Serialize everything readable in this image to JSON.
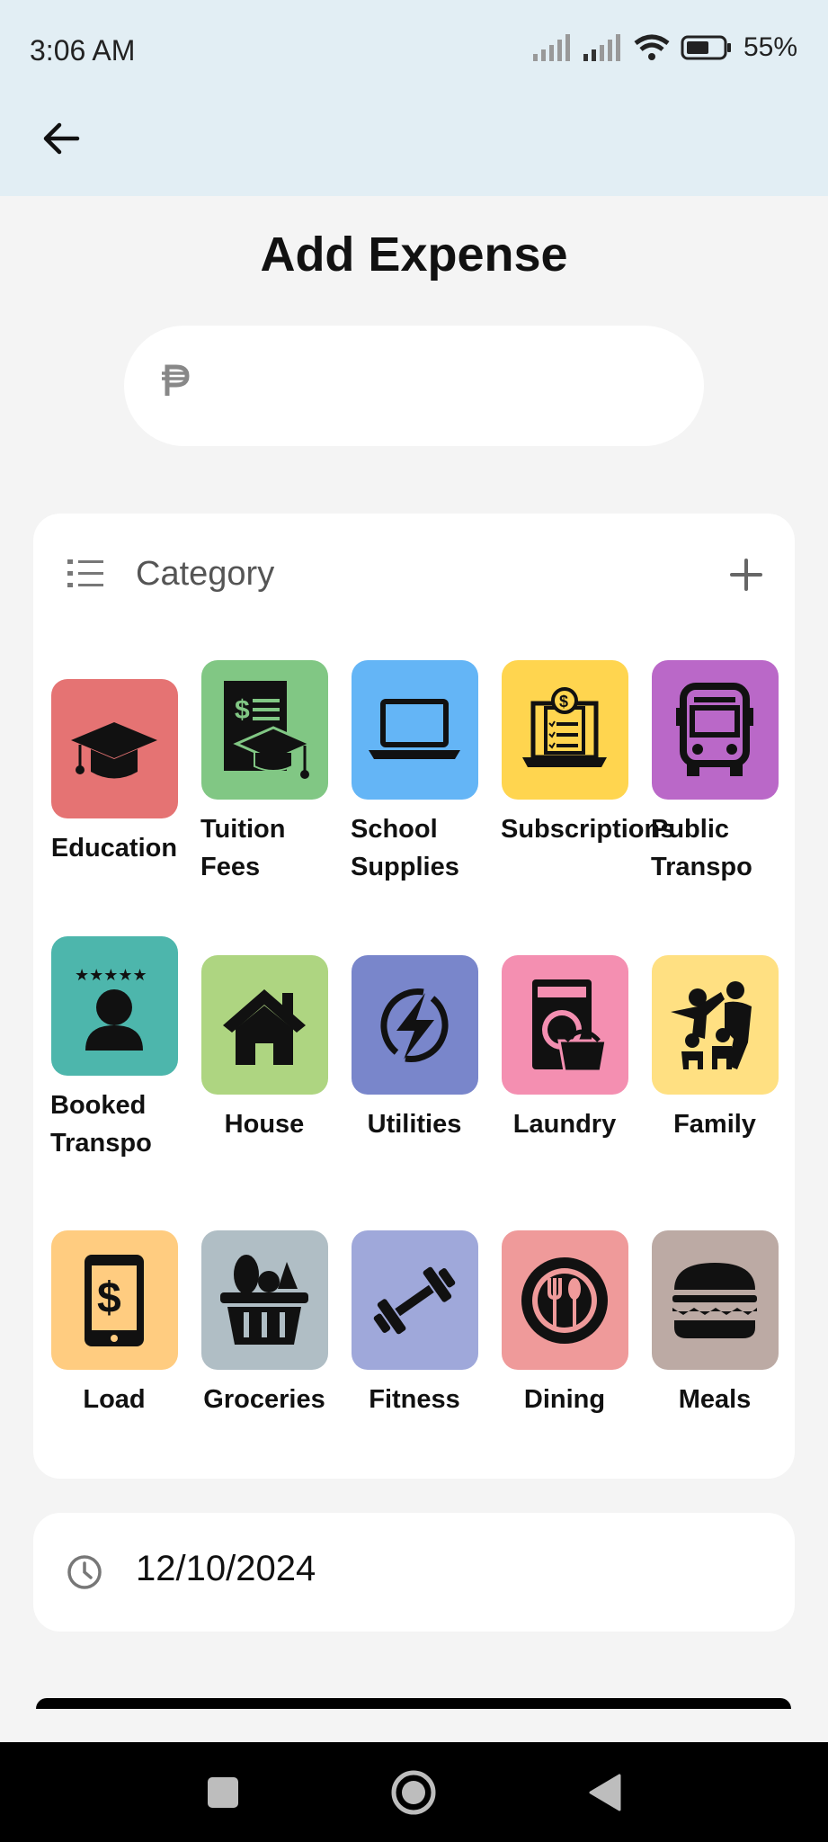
{
  "status_bar": {
    "time": "3:06 AM",
    "battery": "55%"
  },
  "header": {
    "title": "Add Expense"
  },
  "amount": {
    "currency_icon": "peso-icon",
    "value": "",
    "placeholder": ""
  },
  "category": {
    "title": "Category",
    "items": [
      {
        "label": "Education",
        "color": "#e57373",
        "icon": "graduation-cap-icon"
      },
      {
        "label": "Tuition Fees",
        "color": "#81c784",
        "icon": "tuition-document-icon"
      },
      {
        "label": "School Supplies",
        "color": "#64b5f6",
        "icon": "laptop-icon"
      },
      {
        "label": "Subscriptions",
        "color": "#ffd54f",
        "icon": "subscription-invoice-icon"
      },
      {
        "label": "Public Transpo",
        "color": "#ba68c8",
        "icon": "bus-icon"
      },
      {
        "label": "Booked Transpo",
        "color": "#4db6ac",
        "icon": "driver-rating-icon"
      },
      {
        "label": "House",
        "color": "#aed581",
        "icon": "house-icon"
      },
      {
        "label": "Utilities",
        "color": "#7986cb",
        "icon": "lightning-icon"
      },
      {
        "label": "Laundry",
        "color": "#f48fb1",
        "icon": "washing-machine-icon"
      },
      {
        "label": "Family",
        "color": "#ffe082",
        "icon": "family-icon"
      },
      {
        "label": "Load",
        "color": "#ffcc80",
        "icon": "phone-dollar-icon"
      },
      {
        "label": "Groceries",
        "color": "#b0bec5",
        "icon": "grocery-basket-icon"
      },
      {
        "label": "Fitness",
        "color": "#9fa8da",
        "icon": "dumbbell-icon"
      },
      {
        "label": "Dining",
        "color": "#ef9a9a",
        "icon": "plate-utensils-icon"
      },
      {
        "label": "Meals",
        "color": "#bcaaa4",
        "icon": "burger-icon"
      }
    ]
  },
  "date": {
    "value": "12/10/2024"
  }
}
